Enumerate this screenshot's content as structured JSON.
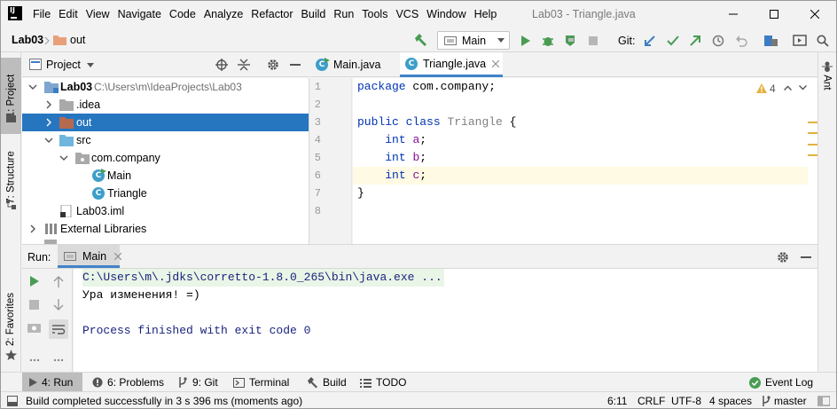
{
  "titlebar": {
    "menu": [
      "File",
      "Edit",
      "View",
      "Navigate",
      "Code",
      "Analyze",
      "Refactor",
      "Build",
      "Run",
      "Tools",
      "VCS",
      "Window",
      "Help"
    ],
    "window_title": "Lab03 - Triangle.java"
  },
  "navbar": {
    "breadcrumb_project": "Lab03",
    "breadcrumb_folder": "out",
    "run_config": "Main",
    "git_label": "Git:"
  },
  "side_tabs": {
    "project": "1: Project",
    "structure": "7: Structure",
    "favorites": "2: Favorites",
    "ant": "Ant"
  },
  "project_panel": {
    "title": "Project",
    "tree": [
      {
        "label": "Lab03",
        "path": "C:\\Users\\m\\IdeaProjects\\Lab03"
      },
      {
        "label": ".idea"
      },
      {
        "label": "out"
      },
      {
        "label": "src"
      },
      {
        "label": "com.company"
      },
      {
        "label": "Main"
      },
      {
        "label": "Triangle"
      },
      {
        "label": "Lab03.iml"
      },
      {
        "label": "External Libraries"
      }
    ]
  },
  "editor": {
    "tabs": [
      "Main.java",
      "Triangle.java"
    ],
    "active_tab": "Triangle.java",
    "warning_count": "4",
    "line_numbers": [
      "1",
      "2",
      "3",
      "4",
      "5",
      "6",
      "7",
      "8"
    ],
    "lines": [
      "package com.company;",
      "",
      "public class Triangle {",
      "    int a;",
      "    int b;",
      "    int c;",
      "}",
      ""
    ]
  },
  "run_panel": {
    "label": "Run:",
    "tab": "Main",
    "console": [
      "C:\\Users\\m\\.jdks\\corretto-1.8.0_265\\bin\\java.exe ...",
      "Ура изменения! =)",
      "",
      "Process finished with exit code 0"
    ]
  },
  "bottom_tabs": [
    "4: Run",
    "6: Problems",
    "9: Git",
    "Terminal",
    "Build",
    "TODO"
  ],
  "event_log": "Event Log",
  "status": {
    "message": "Build completed successfully in 3 s 396 ms (moments ago)",
    "position": "6:11",
    "line_sep": "CRLF",
    "encoding": "UTF-8",
    "indent": "4 spaces",
    "branch": "master"
  },
  "colors": {
    "selection": "#2675bf",
    "keyword": "#0033b3",
    "field": "#871094",
    "console_text": "#1a237e",
    "console_cmd_bg": "#e9f5e6",
    "run_green": "#499c54"
  }
}
